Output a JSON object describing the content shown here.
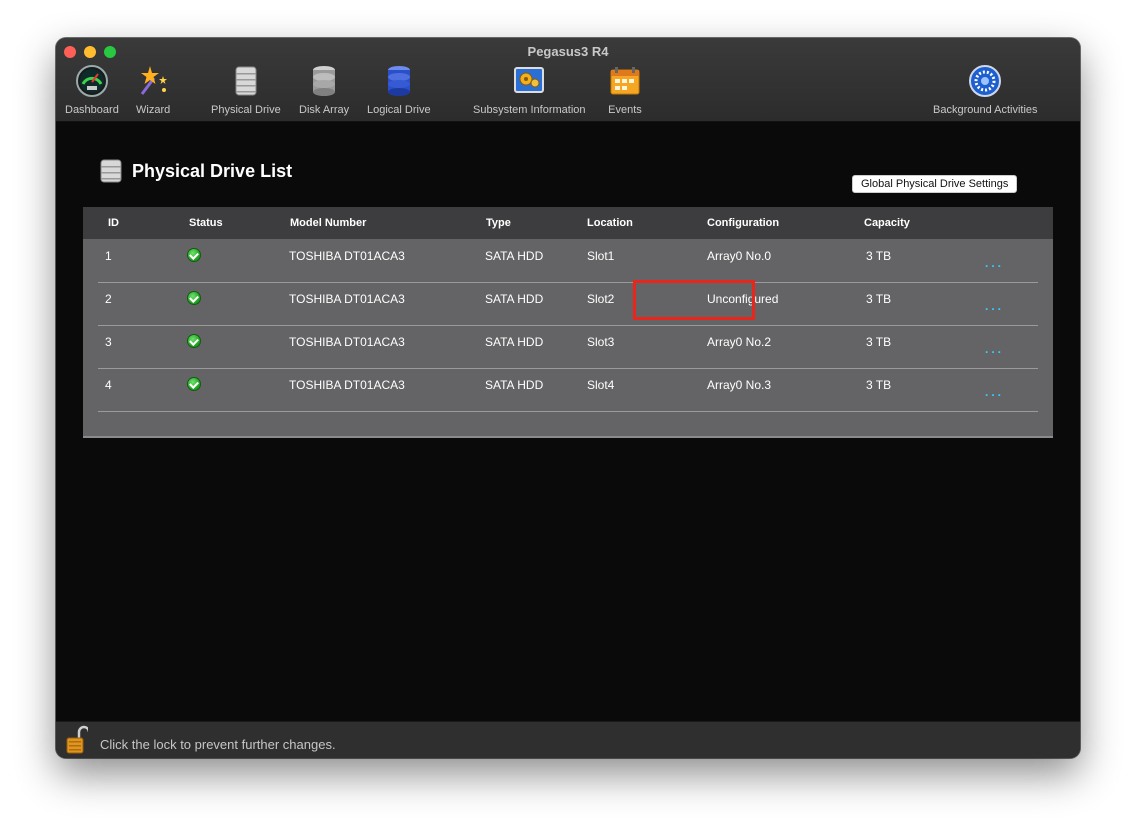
{
  "window": {
    "title": "Pegasus3 R4"
  },
  "toolbar": {
    "items": [
      {
        "label": "Dashboard",
        "icon": "dashboard-gauge-icon"
      },
      {
        "label": "Wizard",
        "icon": "wizard-stars-icon"
      },
      {
        "label": "Physical Drive",
        "icon": "physical-drive-icon"
      },
      {
        "label": "Disk Array",
        "icon": "disk-array-icon"
      },
      {
        "label": "Logical Drive",
        "icon": "logical-drive-icon"
      },
      {
        "label": "Subsystem Information",
        "icon": "subsystem-info-icon"
      },
      {
        "label": "Events",
        "icon": "events-calendar-icon"
      },
      {
        "label": "Background Activities",
        "icon": "background-activities-icon"
      }
    ]
  },
  "page": {
    "title": "Physical Drive List",
    "global_settings_button": "Global Physical Drive Settings"
  },
  "table": {
    "columns": [
      "ID",
      "Status",
      "Model Number",
      "Type",
      "Location",
      "Configuration",
      "Capacity"
    ],
    "rows": [
      {
        "id": "1",
        "status": "ok",
        "model": "TOSHIBA DT01ACA3",
        "type": "SATA HDD",
        "location": "Slot1",
        "configuration": "Array0 No.0",
        "capacity": "3 TB",
        "more": "..."
      },
      {
        "id": "2",
        "status": "ok",
        "model": "TOSHIBA DT01ACA3",
        "type": "SATA HDD",
        "location": "Slot2",
        "configuration": "Unconfigured",
        "capacity": "3 TB",
        "more": "..."
      },
      {
        "id": "3",
        "status": "ok",
        "model": "TOSHIBA DT01ACA3",
        "type": "SATA HDD",
        "location": "Slot3",
        "configuration": "Array0 No.2",
        "capacity": "3 TB",
        "more": "..."
      },
      {
        "id": "4",
        "status": "ok",
        "model": "TOSHIBA DT01ACA3",
        "type": "SATA HDD",
        "location": "Slot4",
        "configuration": "Array0 No.3",
        "capacity": "3 TB",
        "more": "..."
      }
    ]
  },
  "statusbar": {
    "text": "Click the lock to prevent further changes.",
    "icon": "unlocked-padlock-icon"
  },
  "colors": {
    "highlight": "#e8261c",
    "more_link": "#2fd0ff",
    "ok_status": "#1a9a1a"
  }
}
